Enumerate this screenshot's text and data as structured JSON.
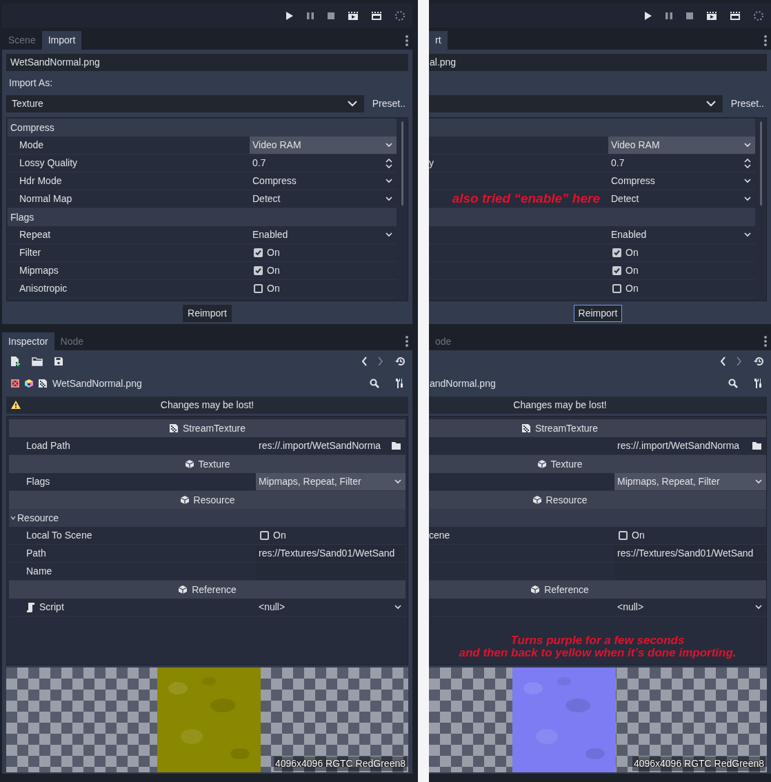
{
  "panels": [
    {
      "dock_tabs": [
        {
          "label": "Scene",
          "selected": false
        },
        {
          "label": "Import",
          "selected": true
        }
      ],
      "import": {
        "file": "WetSandNormal.png",
        "import_as_label": "Import As:",
        "import_as": "Texture",
        "preset_button": "Preset..",
        "sections": [
          {
            "title": "Compress",
            "rows": [
              {
                "label": "Mode",
                "kind": "dropdown",
                "value": "Video RAM",
                "highlighted": true
              },
              {
                "label": "Lossy Quality",
                "kind": "spin",
                "value": "0.7"
              },
              {
                "label": "Hdr Mode",
                "kind": "dropdown",
                "value": "Compress",
                "highlighted": false
              },
              {
                "label": "Normal Map",
                "kind": "dropdown",
                "value": "Detect",
                "highlighted": false
              }
            ]
          },
          {
            "title": "Flags",
            "rows": [
              {
                "label": "Repeat",
                "kind": "dropdown",
                "value": "Enabled",
                "highlighted": false
              },
              {
                "label": "Filter",
                "kind": "checkbox",
                "checked": true,
                "value": "On"
              },
              {
                "label": "Mipmaps",
                "kind": "checkbox",
                "checked": true,
                "value": "On"
              },
              {
                "label": "Anisotropic",
                "kind": "checkbox",
                "checked": false,
                "value": "On"
              }
            ]
          }
        ],
        "reimport_button": "Reimport",
        "reimport_focused": false
      },
      "inspector_tabs": [
        {
          "label": "Inspector",
          "selected": true
        },
        {
          "label": "Node",
          "selected": false
        }
      ],
      "resource_title": "WetSandNormal.png",
      "warning": "Changes may be lost!",
      "inspector_rows": [
        {
          "kind": "header",
          "title": "StreamTexture"
        },
        {
          "kind": "path",
          "label": "Load Path",
          "value": "res://.import/WetSandNorma"
        },
        {
          "kind": "header",
          "title": "Texture"
        },
        {
          "kind": "dropdown",
          "label": "Flags",
          "value": "Mipmaps, Repeat, Filter",
          "highlighted": true
        },
        {
          "kind": "header",
          "title": "Resource"
        },
        {
          "kind": "group",
          "label": "Resource",
          "expanded": true
        },
        {
          "kind": "checkbox",
          "label": "Local To Scene",
          "checked": false,
          "value": "On"
        },
        {
          "kind": "text",
          "label": "Path",
          "value": "res://Textures/Sand01/WetSand"
        },
        {
          "kind": "text",
          "label": "Name"
        },
        {
          "kind": "header",
          "title": "Reference"
        },
        {
          "kind": "script",
          "label": "Script",
          "value": "<null>",
          "highlighted": false
        }
      ],
      "preview": {
        "kind": "picture",
        "color": "#8a8700",
        "info": "4096x4096 RGTC RedGreen8"
      }
    },
    {
      "dock_tabs": [
        {
          "label": "rt",
          "selected": true
        }
      ],
      "import": {
        "file": "al.png",
        "preset_button": "Preset..",
        "sections": [
          {
            "rows": [
              {
                "kind": "dropdown",
                "value": "Video RAM",
                "highlighted": true
              },
              {
                "label": "y",
                "kind": "spin",
                "value": "0.7"
              },
              {
                "kind": "dropdown",
                "value": "Compress",
                "highlighted": false
              },
              {
                "kind": "dropdown",
                "value": "Detect",
                "highlighted": false,
                "note": "also tried “enable” here"
              }
            ]
          },
          {
            "rows": [
              {
                "kind": "dropdown",
                "value": "Enabled",
                "highlighted": false
              },
              {
                "kind": "checkbox",
                "checked": true,
                "value": "On"
              },
              {
                "kind": "checkbox",
                "checked": true,
                "value": "On"
              },
              {
                "kind": "checkbox",
                "checked": false,
                "value": "On"
              }
            ]
          }
        ],
        "reimport_button": "Reimport",
        "reimport_focused": true
      },
      "inspector_tabs": [
        {
          "label": "ode",
          "selected": false
        }
      ],
      "resource_title": "andNormal.png",
      "warning": "Changes may be lost!",
      "inspector_rows": [
        {
          "kind": "header",
          "title": "StreamTexture"
        },
        {
          "kind": "path",
          "value": "res://.import/WetSandNorma"
        },
        {
          "kind": "header",
          "title": "Texture"
        },
        {
          "kind": "dropdown",
          "value": "Mipmaps, Repeat, Filter",
          "highlighted": true
        },
        {
          "kind": "header",
          "title": "Resource"
        },
        {
          "kind": "group"
        },
        {
          "kind": "checkbox",
          "label": "cene",
          "checked": false,
          "value": "On"
        },
        {
          "kind": "text",
          "value": "res://Textures/Sand01/WetSand"
        },
        {
          "kind": "text"
        },
        {
          "kind": "header",
          "title": "Reference"
        },
        {
          "kind": "script",
          "value": "<null>",
          "highlighted": false
        }
      ],
      "inspector_note": "Turns purple for a few seconds\nand then back to yellow when it’s done importing.",
      "preview": {
        "kind": "picture",
        "color": "#7d7cf2",
        "info": "4096x4096 RGTC RedGreen8"
      }
    }
  ]
}
